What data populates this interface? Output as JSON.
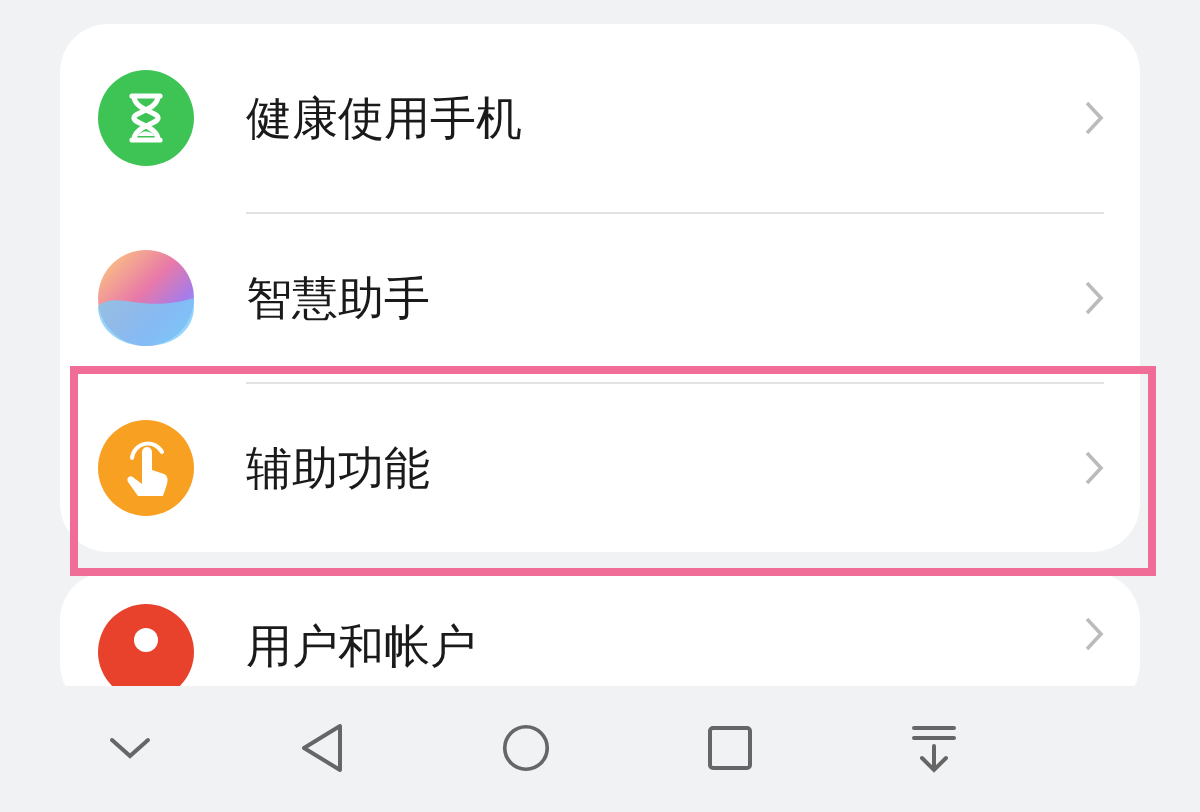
{
  "settings_items": [
    {
      "label": "健康使用手机",
      "kind": "hourglass",
      "highlighted": false
    },
    {
      "label": "智慧助手",
      "kind": "orb",
      "highlighted": false
    },
    {
      "label": "辅助功能",
      "kind": "hand",
      "highlighted": true
    }
  ],
  "partial_item": {
    "label": "用户和帐户",
    "kind": "user"
  },
  "nav_bar": [
    {
      "kind": "hide"
    },
    {
      "kind": "back"
    },
    {
      "kind": "home"
    },
    {
      "kind": "recents"
    },
    {
      "kind": "notifications"
    }
  ]
}
